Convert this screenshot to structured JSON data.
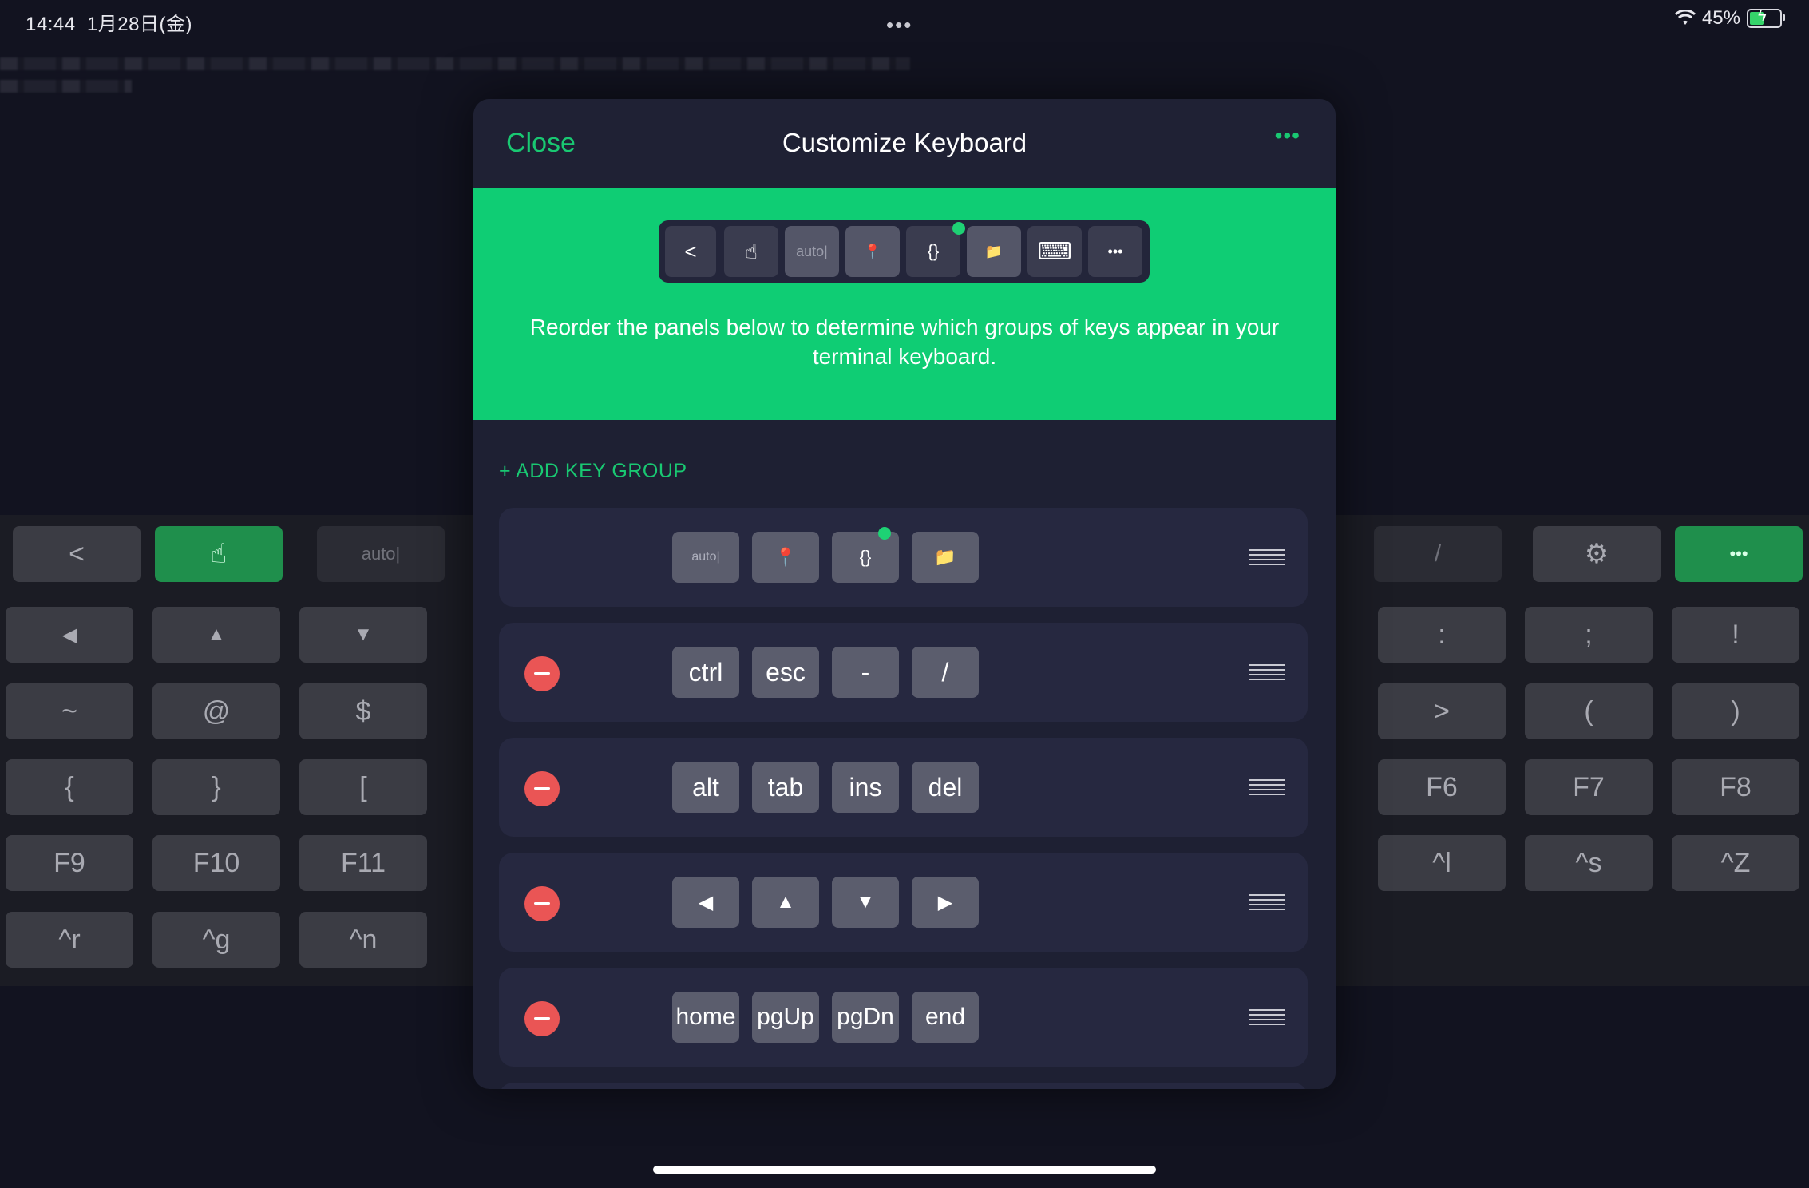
{
  "status": {
    "time": "14:44",
    "date": "1月28日(金)",
    "dots": "•••",
    "battery": "45%"
  },
  "bg_keyboard": {
    "toolbar": [
      "<",
      "☝",
      "auto|",
      "/",
      "⚙",
      "•••"
    ],
    "rows": [
      [
        "◀",
        "▲",
        "▼",
        ":",
        ";",
        "!"
      ],
      [
        "~",
        "@",
        "$",
        ">",
        "(",
        ")"
      ],
      [
        "{",
        "}",
        "[",
        "F6",
        "F7",
        "F8"
      ],
      [
        "F9",
        "F10",
        "F11",
        "^l",
        "^s",
        "^Z"
      ],
      [
        "^r",
        "^g",
        "^n"
      ]
    ]
  },
  "modal": {
    "close_label": "Close",
    "title": "Customize Keyboard",
    "more_label": "•••",
    "toolbar": [
      "<",
      "☝",
      "auto|",
      "📍",
      "{}",
      "📁",
      "⌨",
      "•••"
    ],
    "description": "Reorder the panels below to determine which groups of keys appear in your terminal keyboard.",
    "add_group_label": "+ ADD KEY GROUP",
    "groups": [
      {
        "keys": [
          "auto|",
          "📍",
          "{}",
          "📁"
        ]
      },
      {
        "keys": [
          "ctrl",
          "esc",
          "-",
          "/"
        ]
      },
      {
        "keys": [
          "alt",
          "tab",
          "ins",
          "del"
        ]
      },
      {
        "keys": [
          "◀",
          "▲",
          "▼",
          "▶"
        ]
      },
      {
        "keys": [
          "home",
          "pgUp",
          "pgDn",
          "end"
        ]
      }
    ]
  },
  "colors": {
    "accent": "#19c872",
    "hero": "#0fcd74",
    "danger": "#ea5555",
    "modal_bg": "#1e2033"
  }
}
